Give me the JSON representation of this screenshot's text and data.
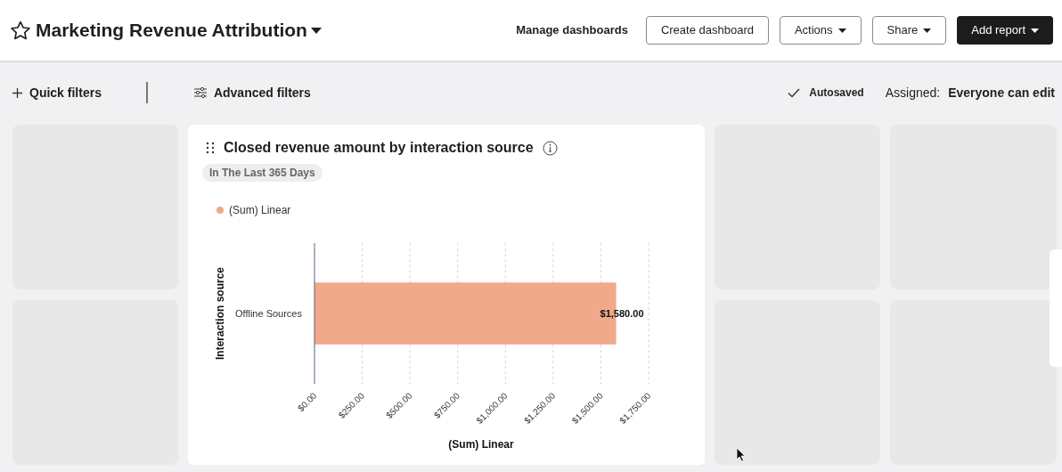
{
  "header": {
    "title": "Marketing Revenue Attribution",
    "buttons": [
      {
        "label": "Manage dashboards",
        "kind": "link",
        "caret": false
      },
      {
        "label": "Create dashboard",
        "kind": "outline",
        "caret": false
      },
      {
        "label": "Actions",
        "kind": "outline",
        "caret": true
      },
      {
        "label": "Share",
        "kind": "outline",
        "caret": true
      },
      {
        "label": "Add report",
        "kind": "primary",
        "caret": true
      }
    ]
  },
  "filter_bar": {
    "quick_filters": "Quick filters",
    "advanced_filters": "Advanced filters",
    "save_status": "Autosaved",
    "assigned_label": "Assigned:",
    "assigned_value": "Everyone can edit"
  },
  "report": {
    "title": "Closed revenue amount by interaction source",
    "date_range": "In The Last 365 Days",
    "chart_data": {
      "type": "bar",
      "orientation": "horizontal",
      "xlabel": "(Sum) Linear",
      "ylabel": "Interaction source",
      "categories": [
        "Offline Sources"
      ],
      "series": [
        {
          "name": "(Sum) Linear",
          "color": "#f0a98a",
          "values": [
            1580
          ]
        }
      ],
      "xlim": [
        0,
        1750
      ],
      "xticks": [
        {
          "value": 0,
          "label": "$0.00"
        },
        {
          "value": 250,
          "label": "$250.00"
        },
        {
          "value": 500,
          "label": "$500.00"
        },
        {
          "value": 750,
          "label": "$750.00"
        },
        {
          "value": 1000,
          "label": "$1,000.00"
        },
        {
          "value": 1250,
          "label": "$1,250.00"
        },
        {
          "value": 1500,
          "label": "$1,500.00"
        },
        {
          "value": 1750,
          "label": "$1,750.00"
        }
      ],
      "grid": true,
      "value_labels": [
        "$1,580.00"
      ]
    }
  }
}
